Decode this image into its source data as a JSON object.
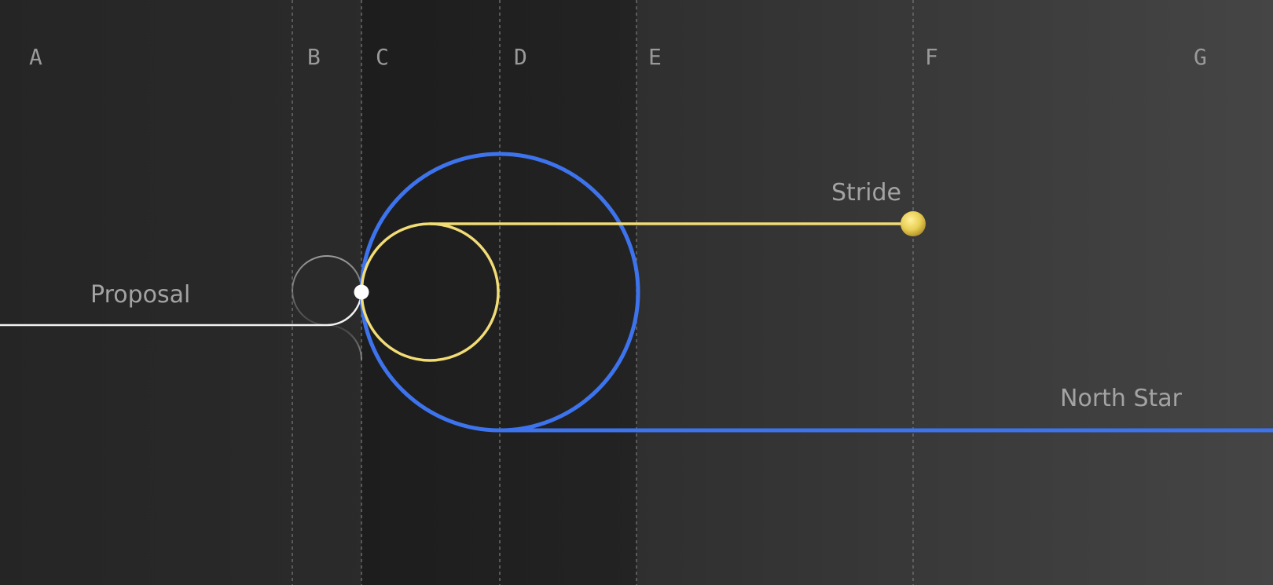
{
  "columns": [
    {
      "label": "A"
    },
    {
      "label": "B"
    },
    {
      "label": "C"
    },
    {
      "label": "D"
    },
    {
      "label": "E"
    },
    {
      "label": "F"
    },
    {
      "label": "G"
    }
  ],
  "labels": {
    "proposal": "Proposal",
    "stride": "Stride",
    "north_star": "North Star"
  },
  "colors": {
    "background": "#252525",
    "panel_dark": "#1f1f1f",
    "background_light": "#444444",
    "gridline": "#6a6a6a",
    "proposal_path": "#f2f2f2",
    "stride_path": "#f1dc76",
    "north_star_path": "#3d74ee",
    "label_text": "#a3a3a3"
  }
}
